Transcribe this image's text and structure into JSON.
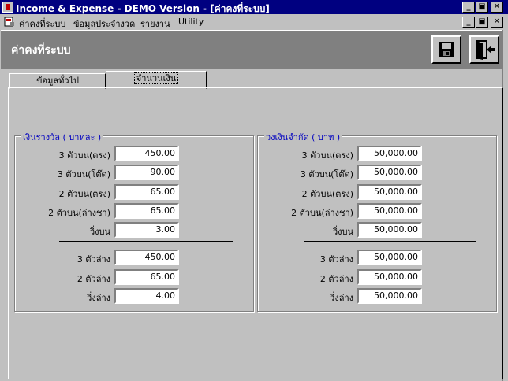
{
  "window": {
    "title": "Income & Expense - DEMO Version - [ค่าคงที่ระบบ]",
    "buttons": [
      "_",
      "▣",
      "✕"
    ]
  },
  "menu": {
    "items": [
      "ค่าคงที่ระบบ",
      "ข้อมูลประจำงวด",
      "รายงาน",
      "Utility"
    ],
    "doc_buttons": [
      "_",
      "▣",
      "✕"
    ]
  },
  "header": {
    "page_title": "ค่าคงที่ระบบ",
    "tool_icons": [
      "save-icon",
      "exit-door-icon"
    ]
  },
  "tabs": [
    {
      "label": "ข้อมูลทั่วไป",
      "active": false
    },
    {
      "label": "จำนวนเงิน",
      "active": true
    }
  ],
  "groups": {
    "prize": {
      "title": "เงินรางวัล ( บาทละ )",
      "upper": [
        {
          "label": "3 ตัวบน(ตรง)",
          "value": "450.00"
        },
        {
          "label": "3 ตัวบน(โต๊ด)",
          "value": "90.00"
        },
        {
          "label": "2 ตัวบน(ตรง)",
          "value": "65.00"
        },
        {
          "label": "2 ตัวบน(ล่างชา)",
          "value": "65.00"
        },
        {
          "label": "วิ่งบน",
          "value": "3.00"
        }
      ],
      "lower": [
        {
          "label": "3 ตัวล่าง",
          "value": "450.00"
        },
        {
          "label": "2 ตัวล่าง",
          "value": "65.00"
        },
        {
          "label": "วิ่งล่าง",
          "value": "4.00"
        }
      ]
    },
    "limit": {
      "title": "วงเงินจำกัด ( บาท )",
      "upper": [
        {
          "label": "3 ตัวบน(ตรง)",
          "value": "50,000.00"
        },
        {
          "label": "3 ตัวบน(โต๊ด)",
          "value": "50,000.00"
        },
        {
          "label": "2 ตัวบน(ตรง)",
          "value": "50,000.00"
        },
        {
          "label": "2 ตัวบน(ล่างชา)",
          "value": "50,000.00"
        },
        {
          "label": "วิ่งบน",
          "value": "50,000.00"
        }
      ],
      "lower": [
        {
          "label": "3 ตัวล่าง",
          "value": "50,000.00"
        },
        {
          "label": "2 ตัวล่าง",
          "value": "50,000.00"
        },
        {
          "label": "วิ่งล่าง",
          "value": "50,000.00"
        }
      ]
    }
  }
}
